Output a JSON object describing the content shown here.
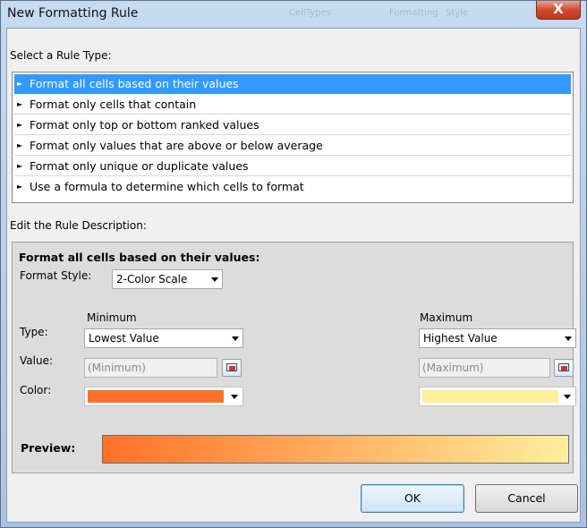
{
  "window": {
    "title": "New Formatting Rule",
    "close_label": "X"
  },
  "background_ghost_text": [
    "CellTypes",
    "Formatting",
    "Style"
  ],
  "rule_type": {
    "heading": "Select a Rule Type:",
    "items": [
      {
        "label": "Format all cells based on their values",
        "selected": true
      },
      {
        "label": "Format only cells that contain",
        "selected": false
      },
      {
        "label": "Format only top or bottom ranked values",
        "selected": false
      },
      {
        "label": "Format only values that are above or below average",
        "selected": false
      },
      {
        "label": "Format only unique or duplicate values",
        "selected": false
      },
      {
        "label": "Use a formula to determine which cells to format",
        "selected": false
      }
    ]
  },
  "description": {
    "heading": "Edit the Rule Description:",
    "title": "Format all cells based on their values:",
    "format_style_label": "Format Style:",
    "format_style_value": "2-Color Scale",
    "row_labels": {
      "type": "Type:",
      "value": "Value:",
      "color": "Color:"
    },
    "minimum": {
      "header": "Minimum",
      "type_value": "Lowest Value",
      "value_placeholder": "(Minimum)",
      "color": "#ff7128"
    },
    "maximum": {
      "header": "Maximum",
      "type_value": "Highest Value",
      "value_placeholder": "(Maximum)",
      "color": "#ffef9c"
    },
    "preview_label": "Preview:"
  },
  "buttons": {
    "ok": "OK",
    "cancel": "Cancel"
  },
  "colors": {
    "selection": "#3399ff",
    "scale_min": "#ff7128",
    "scale_max": "#ffef9c"
  }
}
